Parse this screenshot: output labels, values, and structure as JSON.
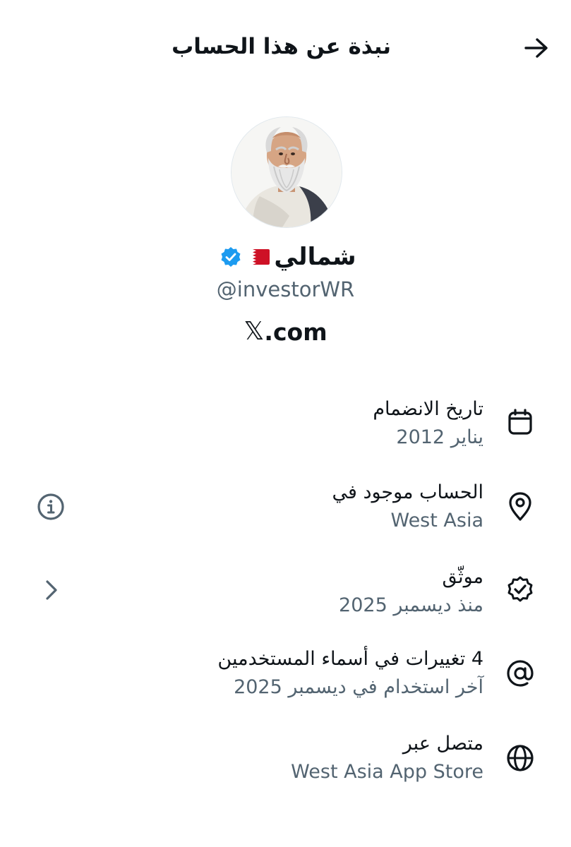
{
  "header": {
    "title": "نبذة عن هذا الحساب",
    "back_icon": "arrow-right-icon"
  },
  "profile": {
    "display_name": "شمالي",
    "flag_icon": "bahrain-flag-icon",
    "verified_icon": "verified-badge-icon",
    "handle": "@investorWR",
    "site_logo": "𝕏",
    "site_suffix": ".com"
  },
  "details": [
    {
      "icon": "calendar-icon",
      "label": "تاريخ الانضمام",
      "value": "يناير 2012"
    },
    {
      "icon": "location-pin-icon",
      "label": "الحساب موجود في",
      "value": "West Asia",
      "action_icon": "info-icon"
    },
    {
      "icon": "verified-check-icon",
      "label": "موثّق",
      "value": "منذ ديسمبر 2025",
      "action_icon": "chevron-right-icon"
    },
    {
      "icon": "at-sign-icon",
      "label": "4 تغييرات في أسماء المستخدمين",
      "value": "آخر استخدام في ديسمبر 2025"
    },
    {
      "icon": "globe-icon",
      "label": "متصل عبر",
      "value": "West Asia App Store"
    }
  ],
  "colors": {
    "text_primary": "#0f1419",
    "text_secondary": "#536471",
    "verified_blue": "#1d9bf0",
    "flag_red": "#ce1126"
  }
}
